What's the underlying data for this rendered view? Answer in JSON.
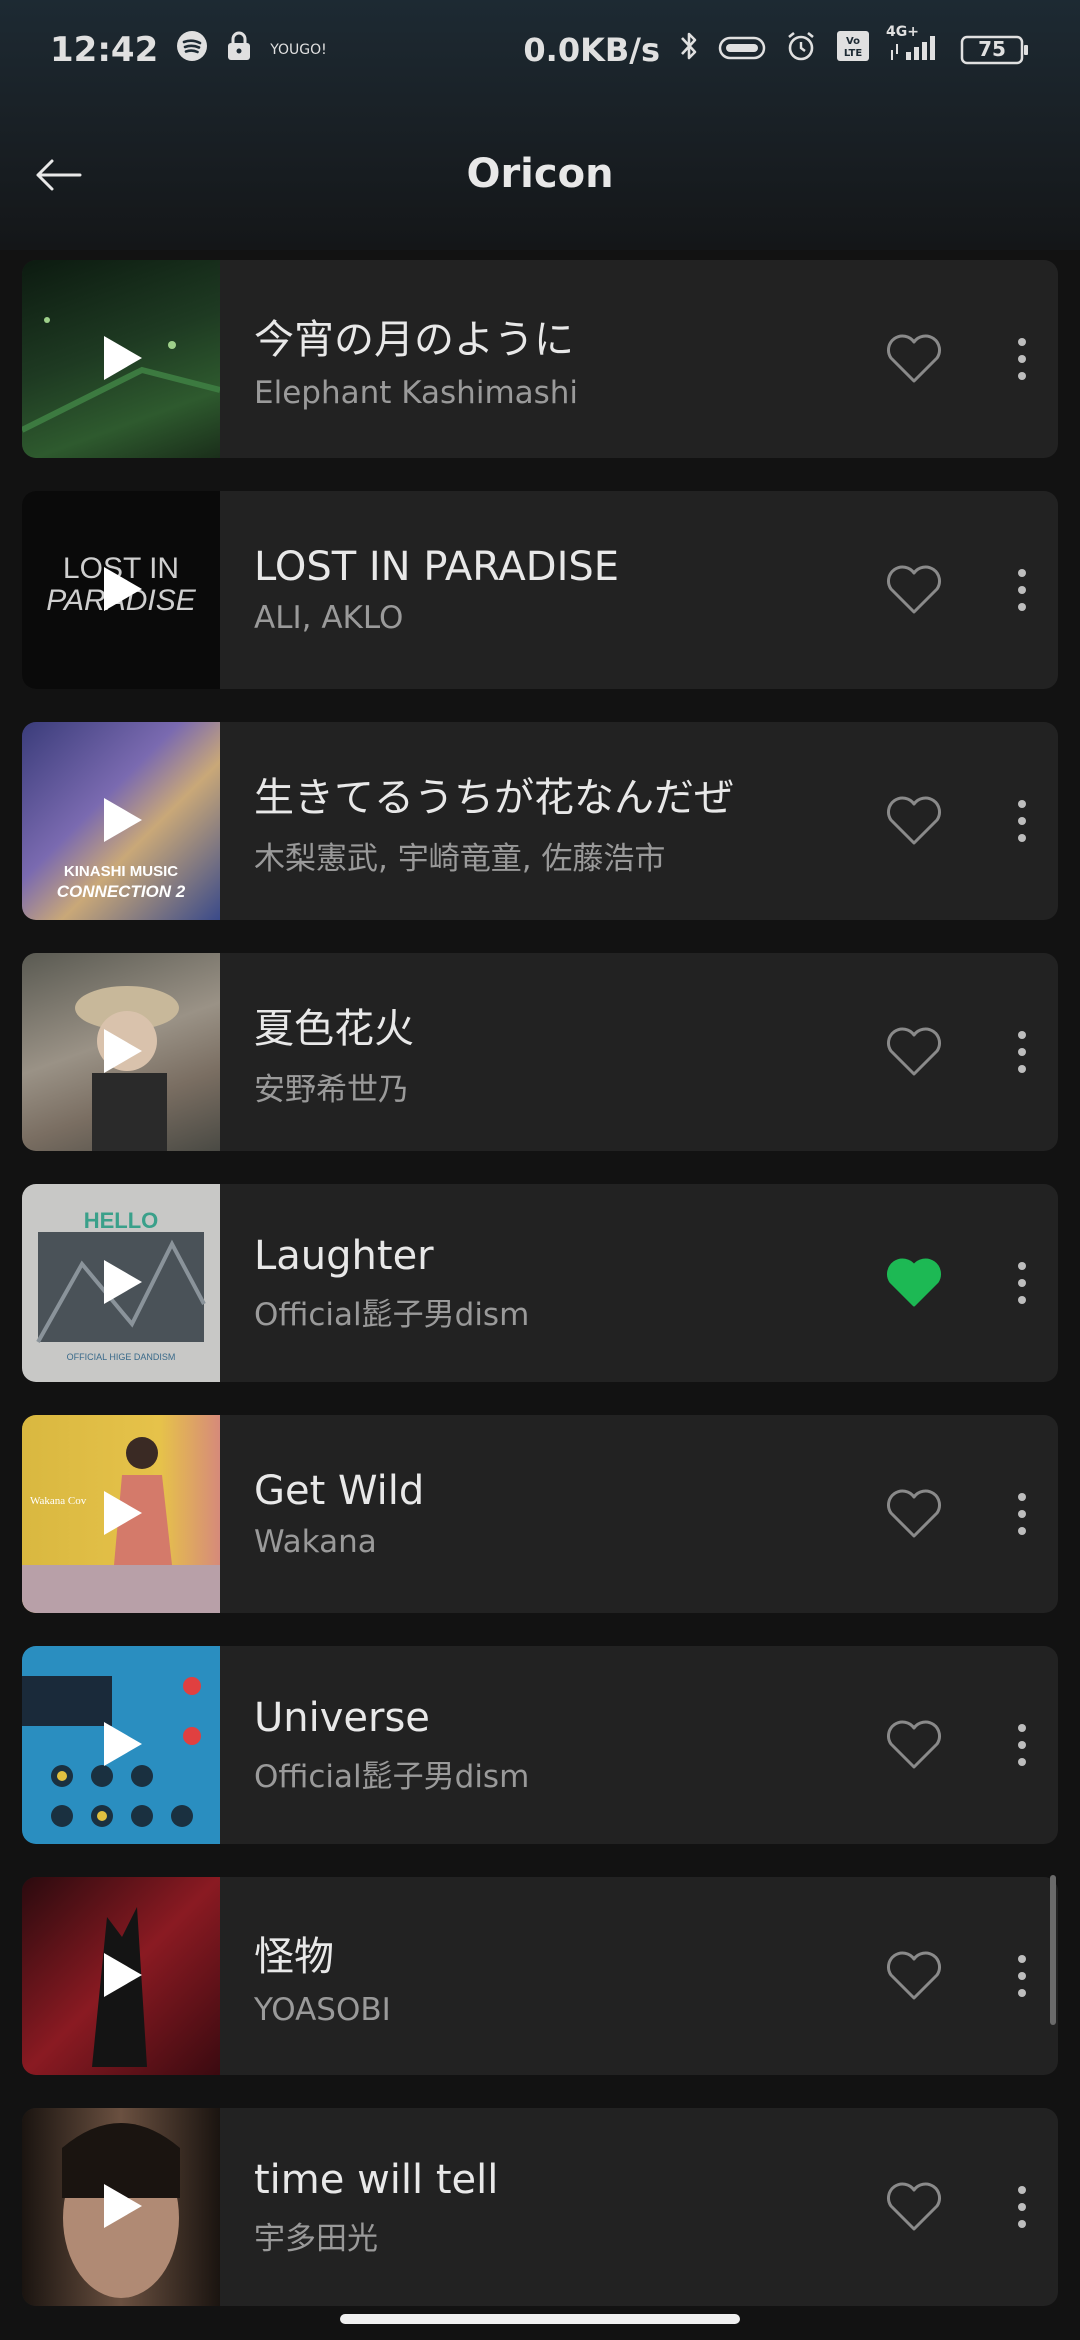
{
  "status": {
    "time": "12:42",
    "tag": "YOUGO!",
    "speed": "0.0KB/s",
    "network": "4G+",
    "volte": "Vo LTE",
    "battery": "75"
  },
  "header": {
    "title": "Oricon"
  },
  "colors": {
    "liked": "#1db954",
    "accent": "#1db954"
  },
  "tracks": [
    {
      "title": "今宵の月のように",
      "artist": "Elephant Kashimashi",
      "liked": false
    },
    {
      "title": "LOST IN PARADISE",
      "artist": "ALI, AKLO",
      "liked": false,
      "cover_text_line1": "LOST IN",
      "cover_text_line2": "PARADISE"
    },
    {
      "title": "生きてるうちが花なんだぜ",
      "artist": "木梨憲武, 宇崎竜童, 佐藤浩市",
      "liked": false,
      "cover_text_line1": "KINASHI MUSIC",
      "cover_text_line2": "CONNECTION 2"
    },
    {
      "title": "夏色花火",
      "artist": "安野希世乃",
      "liked": false
    },
    {
      "title": "Laughter",
      "artist": "Official髭子男dism",
      "liked": true,
      "cover_text_line1": "HELLO",
      "cover_text_line2": "OFFICIAL HIGE DANDISM"
    },
    {
      "title": "Get Wild",
      "artist": "Wakana",
      "liked": false,
      "cover_text_line1": "Wakana Cov"
    },
    {
      "title": "Universe",
      "artist": "Official髭子男dism",
      "liked": false
    },
    {
      "title": "怪物",
      "artist": "YOASOBI",
      "liked": false
    },
    {
      "title": "time will tell",
      "artist": "宇多田光",
      "liked": false
    }
  ]
}
